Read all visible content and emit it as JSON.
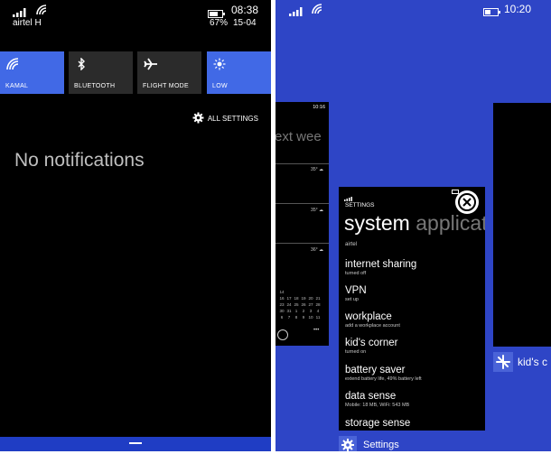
{
  "left_phone": {
    "status": {
      "carrier": "airtel H",
      "time": "08:38",
      "battery": "67%",
      "date": "15-04"
    },
    "quick_actions": [
      {
        "label": "KAMAL",
        "icon": "wifi-icon",
        "active": true
      },
      {
        "label": "BLUETOOTH",
        "icon": "bluetooth-icon",
        "active": false
      },
      {
        "label": "FLIGHT MODE",
        "icon": "airplane-icon",
        "active": false
      },
      {
        "label": "LOW",
        "icon": "brightness-icon",
        "active": true
      }
    ],
    "all_settings_label": "ALL SETTINGS",
    "empty_message": "No notifications"
  },
  "right_phone": {
    "status": {
      "time": "10:20"
    },
    "calendar_card": {
      "time": "10:16",
      "heading": "ext wee",
      "temps": [
        "35°",
        "35°",
        "36°"
      ],
      "calendar_rows": [
        [
          "14",
          "",
          "",
          "",
          "",
          "",
          ""
        ],
        [
          "16",
          "17",
          "18",
          "19",
          "20",
          "21",
          "22"
        ],
        [
          "23",
          "24",
          "25",
          "26",
          "27",
          "28",
          "29"
        ],
        [
          "30",
          "31",
          "1",
          "2",
          "3",
          "4",
          "5"
        ],
        [
          "6",
          "7",
          "8",
          "9",
          "10",
          "11",
          "12"
        ]
      ],
      "more": "•••"
    },
    "settings_card": {
      "app_label": "SETTINGS",
      "title": "system",
      "next_pivot": "applicat",
      "carrier": "airtel",
      "items": [
        {
          "title": "internet sharing",
          "sub": "turned off"
        },
        {
          "title": "VPN",
          "sub": "set up"
        },
        {
          "title": "workplace",
          "sub": "add a workplace account"
        },
        {
          "title": "kid's corner",
          "sub": "turned on"
        },
        {
          "title": "battery saver",
          "sub": "extend battery life, 49% battery left"
        },
        {
          "title": "data sense",
          "sub": "Mobile: 18 MB, WiFi: 543 MB"
        },
        {
          "title": "storage sense",
          "sub": ""
        }
      ],
      "caption": "Settings"
    },
    "kids_card": {
      "caption": "kid's c"
    }
  },
  "colors": {
    "accent": "#4169e6",
    "right_bg": "#2e45c6",
    "tile_off": "#2b2b2b"
  }
}
